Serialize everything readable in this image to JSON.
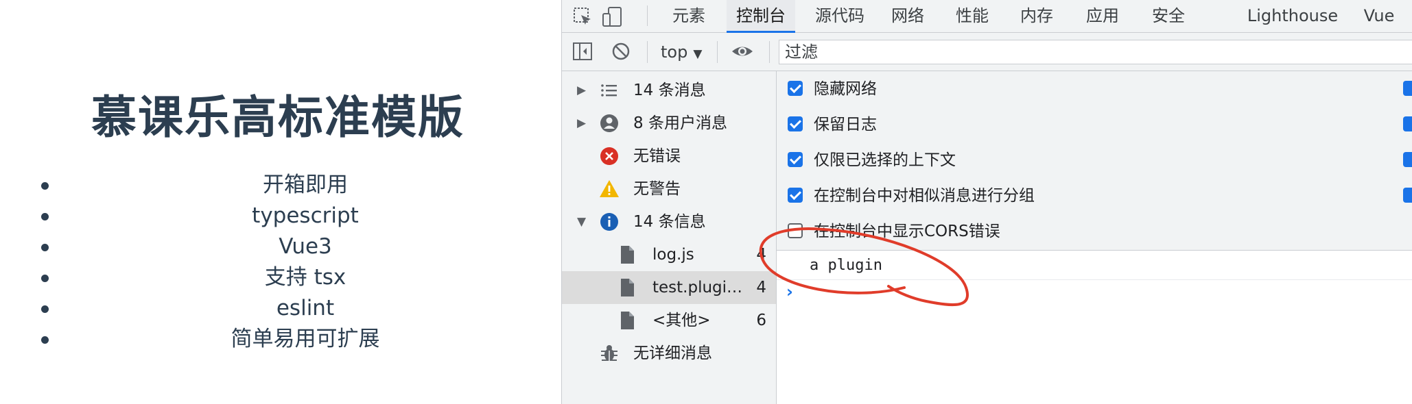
{
  "slide": {
    "title": "慕课乐高标准模版",
    "items": [
      "开箱即用",
      "typescript",
      "Vue3",
      "支持 tsx",
      "eslint",
      "简单易用可扩展"
    ]
  },
  "devtools": {
    "tabs": [
      {
        "label": "元素"
      },
      {
        "label": "控制台"
      },
      {
        "label": "源代码"
      },
      {
        "label": "网络"
      },
      {
        "label": "性能"
      },
      {
        "label": "内存"
      },
      {
        "label": "应用"
      },
      {
        "label": "安全"
      },
      {
        "label": "Lighthouse"
      },
      {
        "label": "Vue"
      }
    ],
    "active_tab": "控制台",
    "toolbar": {
      "context": "top",
      "filter_placeholder": "过滤"
    },
    "sidebar": {
      "items": [
        {
          "label": "14 条消息",
          "icon": "list-icon",
          "expandable": true
        },
        {
          "label": "8 条用户消息",
          "icon": "user-icon",
          "expandable": true
        },
        {
          "label": "无错误",
          "icon": "error-icon"
        },
        {
          "label": "无警告",
          "icon": "warning-icon"
        },
        {
          "label": "14 条信息",
          "icon": "info-icon",
          "expanded": true
        },
        {
          "label": "log.js",
          "icon": "file-icon",
          "count": "4"
        },
        {
          "label": "test.plugi…",
          "icon": "file-icon",
          "count": "4",
          "selected": true
        },
        {
          "label": "<其他>",
          "icon": "file-icon",
          "count": "6"
        },
        {
          "label": "无详细消息",
          "icon": "bug-icon"
        }
      ]
    },
    "settings": [
      {
        "label": "隐藏网络",
        "checked": true
      },
      {
        "label": "保留日志",
        "checked": true
      },
      {
        "label": "仅限已选择的上下文",
        "checked": true
      },
      {
        "label": "在控制台中对相似消息进行分组",
        "checked": true
      },
      {
        "label": "在控制台中显示CORS错误",
        "checked": false
      }
    ],
    "console": {
      "message": "a plugin"
    }
  },
  "colors": {
    "accent": "#1a73e8",
    "annotation": "#e03c2a",
    "slide_text": "#2c3e50",
    "panel_bg": "#f1f3f4"
  }
}
